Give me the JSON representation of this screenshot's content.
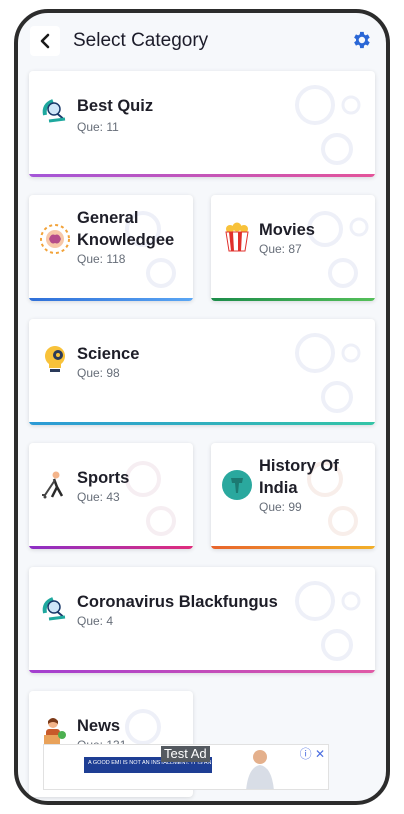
{
  "header": {
    "title": "Select Category"
  },
  "count_prefix": "Que: ",
  "categories": [
    {
      "name": "Best Quiz",
      "count": "Que: 11",
      "bar": [
        "#a456d8",
        "#e4549a"
      ],
      "icon": "quiz-icon"
    },
    {
      "name": "General Knowledgee",
      "count": "Que: 118",
      "bar": [
        "#2f6fd8",
        "#5aa6f4"
      ],
      "icon": "brain-icon"
    },
    {
      "name": "Movies",
      "count": "Que: 87",
      "bar": [
        "#1c8c4a",
        "#55c05a"
      ],
      "icon": "popcorn-icon"
    },
    {
      "name": "Science",
      "count": "Que: 98",
      "bar": [
        "#2c9ad6",
        "#33c4a6"
      ],
      "icon": "lightbulb-gear-icon"
    },
    {
      "name": "Sports",
      "count": "Que: 43",
      "bar": [
        "#8c2fc6",
        "#e02c7c"
      ],
      "icon": "hockey-player-icon"
    },
    {
      "name": "History Of India",
      "count": "Que: 99",
      "bar": [
        "#e8642c",
        "#f2b02a"
      ],
      "icon": "india-map-icon"
    },
    {
      "name": "Coronavirus Blackfungus",
      "count": "Que: 4",
      "bar": [
        "#a33fd0",
        "#e05aa6"
      ],
      "icon": "quiz-icon"
    },
    {
      "name": "News",
      "count": "Que: 131",
      "bar": [
        "#2f6fd8",
        "#5aa6f4"
      ],
      "icon": "news-reporter-icon"
    }
  ],
  "ad": {
    "label": "Test Ad",
    "banner_text": "A GOOD EMI IS NOT AN INSTALLMENT. IT IS AN INVESTMENT.",
    "close": "ⓘ ✕"
  }
}
